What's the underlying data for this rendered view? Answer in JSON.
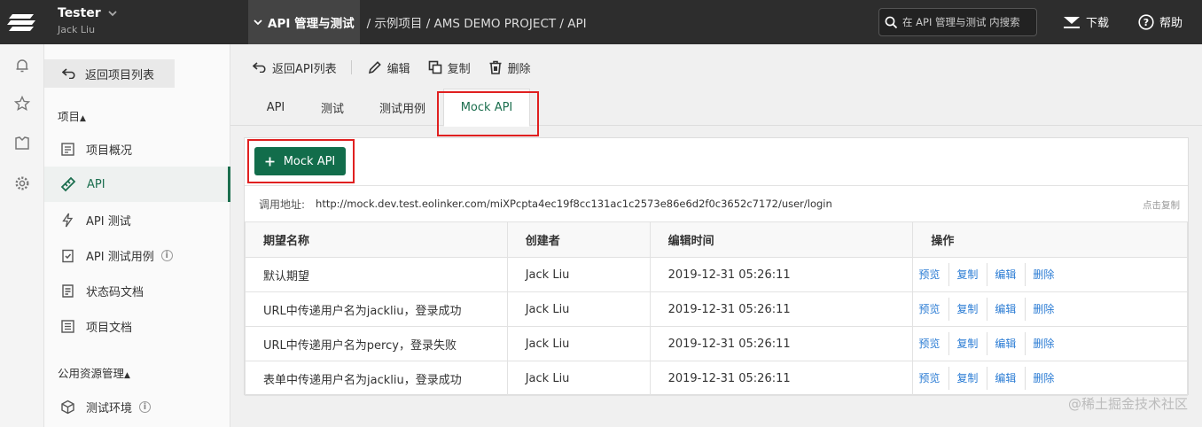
{
  "topbar": {
    "user_name": "Tester",
    "user_sub": "Jack Liu",
    "crumb_first": "API 管理与测试",
    "crumb_rest": "/ 示例项目 / AMS DEMO PROJECT / API",
    "search_placeholder": "在 API 管理与测试 内搜索",
    "download_label": "下载",
    "help_label": "帮助"
  },
  "sidebar": {
    "back_label": "返回项目列表",
    "section_project": "项目",
    "items": [
      {
        "label": "项目概况"
      },
      {
        "label": "API"
      },
      {
        "label": "API 测试"
      },
      {
        "label": "API 测试用例"
      },
      {
        "label": "状态码文档"
      },
      {
        "label": "项目文档"
      }
    ],
    "section_public": "公用资源管理",
    "public_items": [
      {
        "label": "测试环境"
      }
    ]
  },
  "toolbar": {
    "back_label": "返回API列表",
    "edit_label": "编辑",
    "copy_label": "复制",
    "delete_label": "删除"
  },
  "tabs": [
    {
      "label": "API"
    },
    {
      "label": "测试"
    },
    {
      "label": "测试用例"
    },
    {
      "label": "Mock API"
    }
  ],
  "panel": {
    "add_button": "Mock API",
    "url_label": "调用地址:",
    "url_value": "http://mock.dev.test.eolinker.com/miXPcpta4ec19f8cc131ac1c2573e86e6d2f0c3652c7172/user/login",
    "copy_label": "点击复制"
  },
  "table": {
    "headers": [
      "期望名称",
      "创建者",
      "编辑时间",
      "操作"
    ],
    "rows": [
      {
        "name": "默认期望",
        "creator": "Jack Liu",
        "time": "2019-12-31 05:26:11"
      },
      {
        "name": "URL中传递用户名为jackliu，登录成功",
        "creator": "Jack Liu",
        "time": "2019-12-31 05:26:11"
      },
      {
        "name": "URL中传递用户名为percy，登录失败",
        "creator": "Jack Liu",
        "time": "2019-12-31 05:26:11"
      },
      {
        "name": "表单中传递用户名为jackliu，登录成功",
        "creator": "Jack Liu",
        "time": "2019-12-31 05:26:11"
      }
    ],
    "ops": [
      "预览",
      "复制",
      "编辑",
      "删除"
    ]
  },
  "watermark": "@稀土掘金技术社区",
  "colors": {
    "accent": "#126d4b",
    "highlight": "#e02020",
    "link": "#2b7cd4"
  }
}
